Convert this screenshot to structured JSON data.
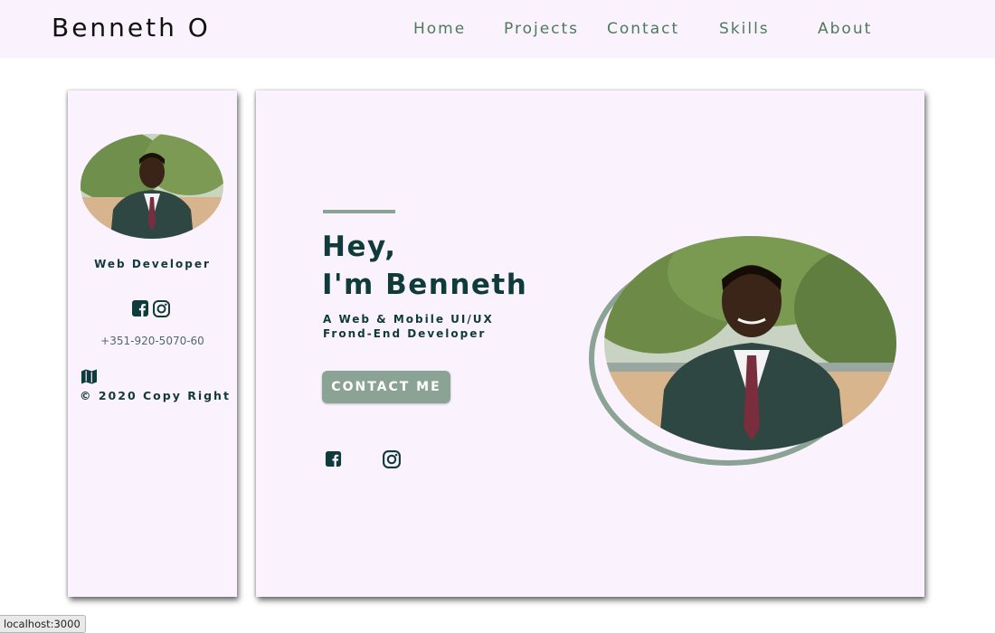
{
  "brand": "Benneth O",
  "nav": [
    "Home",
    "Projects",
    "Contact",
    "Skills",
    "About"
  ],
  "sidebar": {
    "role": "Web Developer",
    "phone": "+351-920-5070-60",
    "copyright": "© 2020 Copy Right",
    "icons": [
      "facebook-icon",
      "instagram-icon",
      "map-icon"
    ]
  },
  "hero": {
    "greeting_line1": "Hey,",
    "greeting_line2": "I'm Benneth",
    "tagline_line1": "A Web & Mobile UI/UX",
    "tagline_line2": "Frond-End Developer",
    "cta": "CONTACT ME"
  },
  "status_url": "localhost:3000",
  "colors": {
    "nav_bg": "#faf2fc",
    "card_bg": "#faf2fc",
    "accent": "#8ba394",
    "heading": "#0f3b3b",
    "nav_text": "#4e7a5c"
  }
}
